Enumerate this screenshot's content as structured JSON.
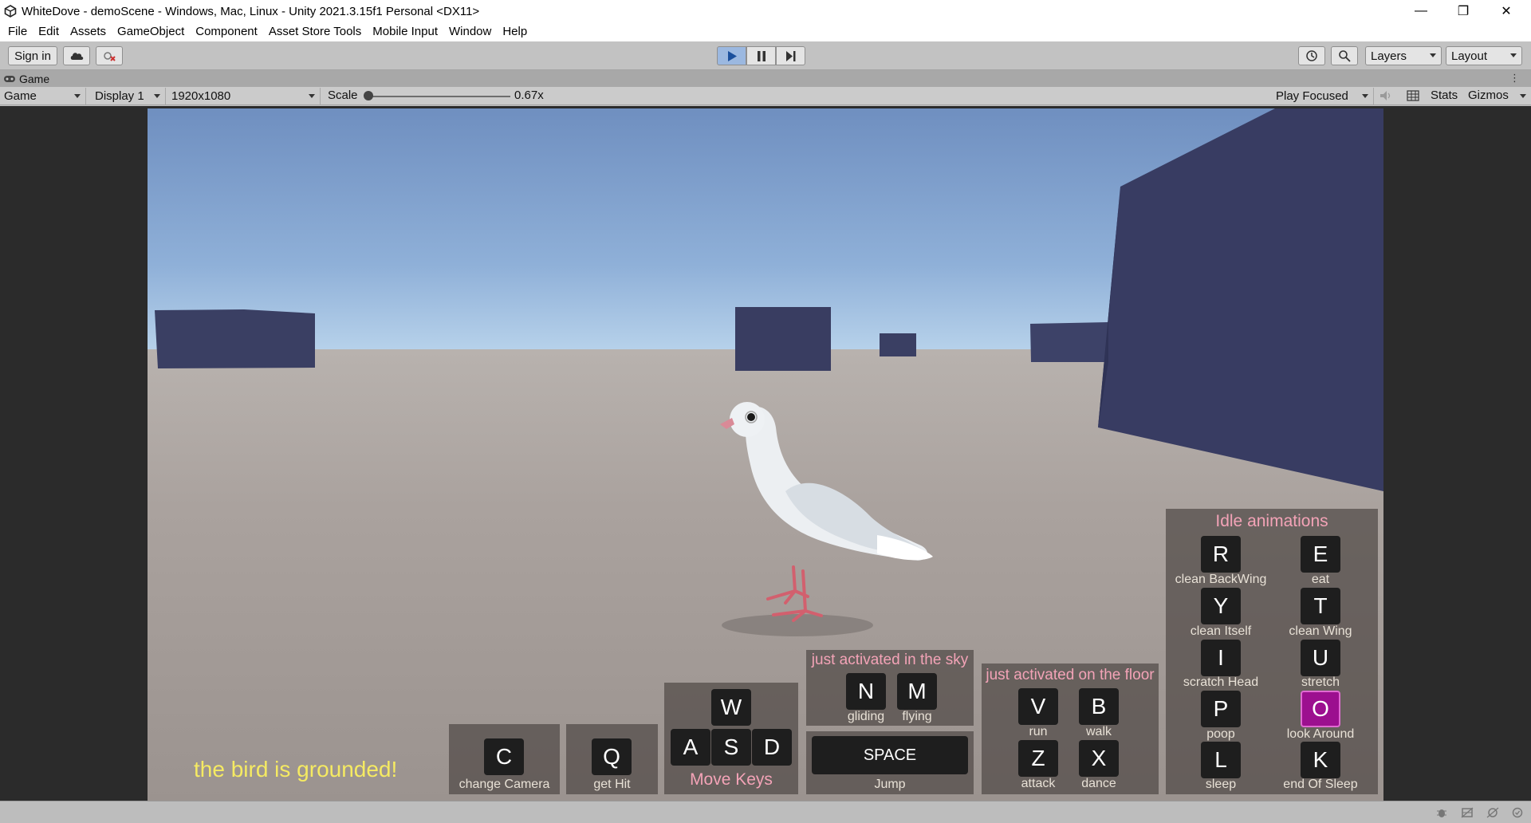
{
  "window": {
    "title": "WhiteDove - demoScene - Windows, Mac, Linux - Unity 2021.3.15f1 Personal <DX11>",
    "controls": {
      "minimize": "—",
      "restore": "❐",
      "close": "✕"
    }
  },
  "menu": [
    "File",
    "Edit",
    "Assets",
    "GameObject",
    "Component",
    "Asset Store Tools",
    "Mobile Input",
    "Window",
    "Help"
  ],
  "toolbar": {
    "sign_in": "Sign in",
    "layers": "Layers",
    "layout": "Layout",
    "play_state": "playing"
  },
  "game_view": {
    "tab": "Game",
    "mode": "Game",
    "display": "Display 1",
    "resolution": "1920x1080",
    "scale_label": "Scale",
    "scale_value": "0.67x",
    "play_focus": "Play Focused",
    "stats": "Stats",
    "gizmos": "Gizmos"
  },
  "hud": {
    "status": "the bird is grounded!",
    "change_camera": {
      "key": "C",
      "label": "change Camera"
    },
    "get_hit": {
      "key": "Q",
      "label": "get Hit"
    },
    "move": {
      "keys": [
        "W",
        "A",
        "S",
        "D"
      ],
      "label": "Move Keys"
    },
    "sky": {
      "title": "just activated in the sky",
      "keys": [
        {
          "key": "N",
          "label": "gliding"
        },
        {
          "key": "M",
          "label": "flying"
        }
      ]
    },
    "jump": {
      "key": "SPACE",
      "label": "Jump"
    },
    "floor": {
      "title": "just activated on the floor",
      "keys": [
        {
          "key": "V",
          "label": "run"
        },
        {
          "key": "B",
          "label": "walk"
        },
        {
          "key": "Z",
          "label": "attack"
        },
        {
          "key": "X",
          "label": "dance"
        }
      ]
    },
    "idle": {
      "title": "Idle animations",
      "keys": [
        {
          "key": "R",
          "label": "clean BackWing"
        },
        {
          "key": "E",
          "label": "eat"
        },
        {
          "key": "Y",
          "label": "clean Itself"
        },
        {
          "key": "T",
          "label": "clean Wing"
        },
        {
          "key": "I",
          "label": "scratch Head"
        },
        {
          "key": "U",
          "label": "stretch"
        },
        {
          "key": "P",
          "label": "poop"
        },
        {
          "key": "O",
          "label": "look Around"
        },
        {
          "key": "L",
          "label": "sleep"
        },
        {
          "key": "K",
          "label": "end Of Sleep"
        }
      ],
      "active_key": "O"
    }
  },
  "colors": {
    "status_text": "#f5ea62",
    "panel_title": "#f3a3b7",
    "active_key": "#9c0f8f",
    "play_active": "#9bb8e0"
  }
}
